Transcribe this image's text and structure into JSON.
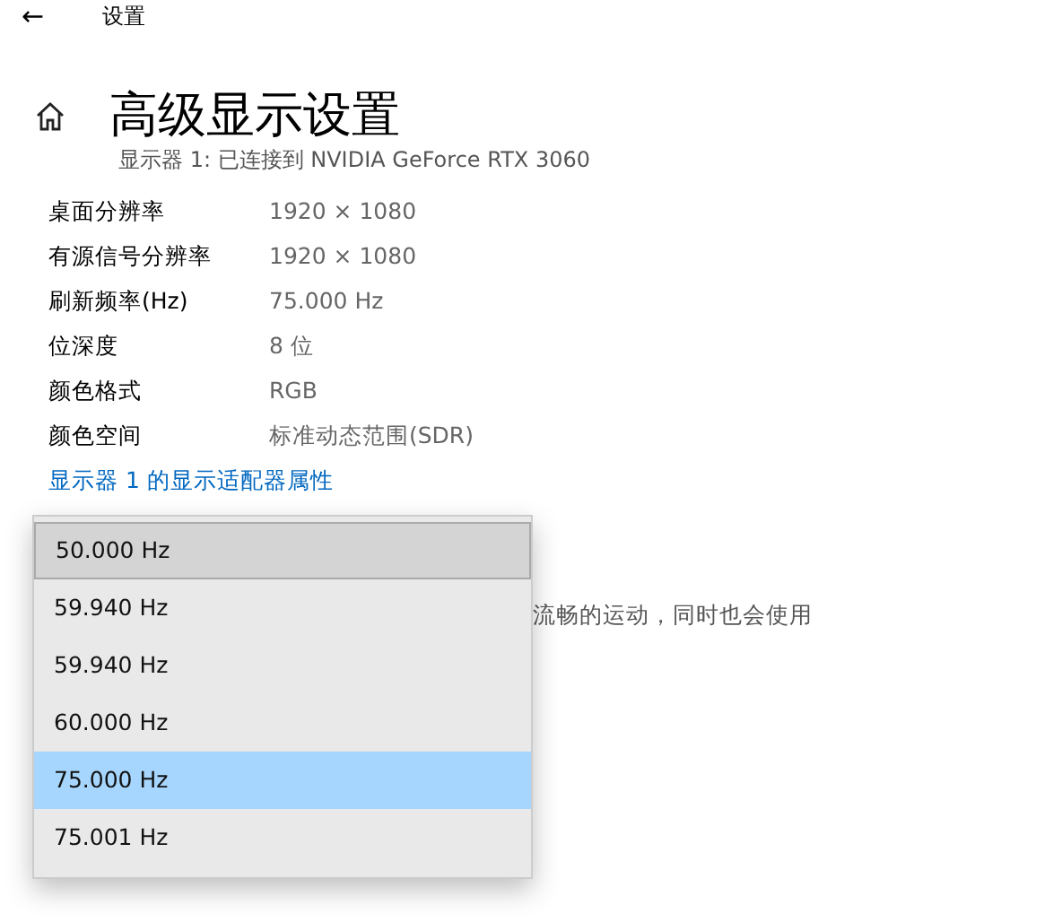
{
  "header": {
    "back": "←",
    "title": "设置"
  },
  "page": {
    "title": "高级显示设置",
    "subtitle": "显示器 1: 已连接到 NVIDIA GeForce RTX 3060"
  },
  "info": [
    {
      "label": "桌面分辨率",
      "value": "1920 × 1080"
    },
    {
      "label": "有源信号分辨率",
      "value": "1920 × 1080"
    },
    {
      "label": "刷新频率(Hz)",
      "value": "75.000 Hz"
    },
    {
      "label": "位深度",
      "value": "8 位"
    },
    {
      "label": "颜色格式",
      "value": "RGB"
    },
    {
      "label": "颜色空间",
      "value": "标准动态范围(SDR)"
    }
  ],
  "link": "显示器 1 的显示适配器属性",
  "description": "流畅的运动，同时也会使用",
  "dropdown": [
    {
      "label": "50.000 Hz",
      "selected": false,
      "hovered": true
    },
    {
      "label": "59.940 Hz",
      "selected": false,
      "hovered": false
    },
    {
      "label": "59.940 Hz",
      "selected": false,
      "hovered": false
    },
    {
      "label": "60.000 Hz",
      "selected": false,
      "hovered": false
    },
    {
      "label": "75.000 Hz",
      "selected": true,
      "hovered": false
    },
    {
      "label": "75.001 Hz",
      "selected": false,
      "hovered": false
    }
  ]
}
